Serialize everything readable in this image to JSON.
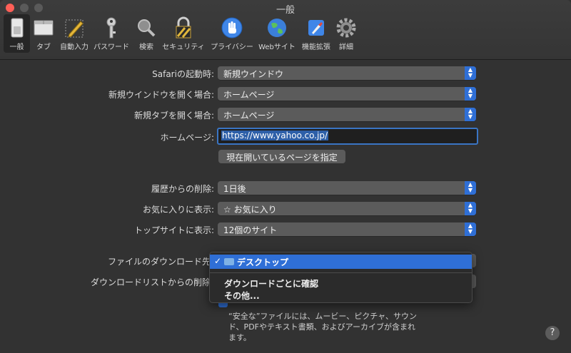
{
  "window": {
    "title": "一般"
  },
  "toolbar": {
    "items": [
      {
        "label": "一般",
        "icon": "general-switch-icon"
      },
      {
        "label": "タブ",
        "icon": "tabs-icon"
      },
      {
        "label": "自動入力",
        "icon": "autofill-pencil-icon"
      },
      {
        "label": "パスワード",
        "icon": "key-icon"
      },
      {
        "label": "検索",
        "icon": "magnifier-icon"
      },
      {
        "label": "セキュリティ",
        "icon": "padlock-icon"
      },
      {
        "label": "プライバシー",
        "icon": "hand-icon"
      },
      {
        "label": "Webサイト",
        "icon": "globe-icon"
      },
      {
        "label": "機能拡張",
        "icon": "puzzle-icon"
      },
      {
        "label": "詳細",
        "icon": "gear-icon"
      }
    ]
  },
  "settings": {
    "startup": {
      "label": "Safariの起動時:",
      "value": "新規ウインドウ"
    },
    "new_window": {
      "label": "新規ウインドウを開く場合:",
      "value": "ホームページ"
    },
    "new_tab": {
      "label": "新規タブを開く場合:",
      "value": "ホームページ"
    },
    "homepage": {
      "label": "ホームページ:",
      "value": "https://www.yahoo.co.jp/"
    },
    "set_current_button": "現在開いているページを指定",
    "history_remove": {
      "label": "履歴からの削除:",
      "value": "1日後"
    },
    "favorites_show": {
      "label": "お気に入りに表示:",
      "value": "お気に入り"
    },
    "topsites_show": {
      "label": "トップサイトに表示:",
      "value": "12個のサイト"
    },
    "download_location": {
      "label": "ファイルのダウンロード先"
    },
    "download_list_remove": {
      "label": "ダウンロードリストからの削除"
    }
  },
  "dropdown_menu": {
    "selected": "デスクトップ",
    "options": [
      "ダウンロードごとに確認",
      "その他..."
    ]
  },
  "safe_files": {
    "description": "“安全な”ファイルには、ムービー、ピクチャ、サウンド、PDFやテキスト書類、およびアーカイブが含まれます。"
  },
  "help_label": "?",
  "colors": {
    "accent": "#2f6fd6",
    "background": "#323232"
  }
}
